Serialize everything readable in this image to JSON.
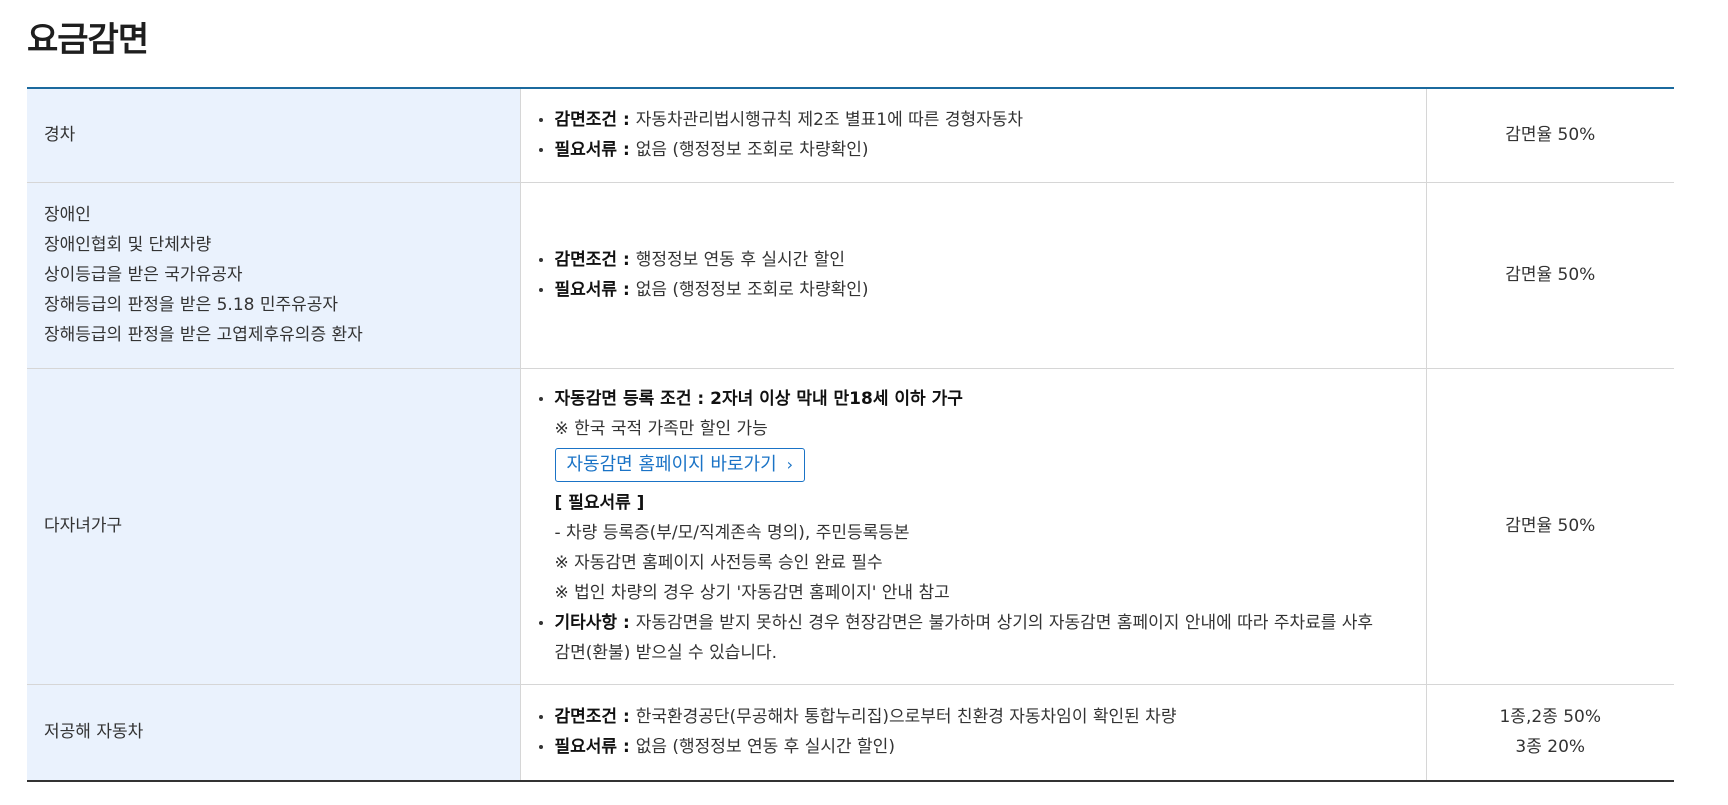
{
  "page_title": "요금감면",
  "rows": [
    {
      "targets": [
        "경차"
      ],
      "items": [
        {
          "label": "감면조건",
          "text": "자동차관리법시행규칙 제2조 별표1에 따른 경형자동차"
        },
        {
          "label": "필요서류",
          "text": "없음 (행정정보 조회로 차량확인)"
        }
      ],
      "rate": [
        "감면율 50%"
      ]
    },
    {
      "targets": [
        "장애인",
        "장애인협회 및 단체차량",
        "상이등급을 받은 국가유공자",
        "장해등급의 판정을 받은 5.18 민주유공자",
        "장해등급의 판정을 받은 고엽제후유의증 환자"
      ],
      "items": [
        {
          "label": "감면조건",
          "text": "행정정보 연동 후 실시간 할인"
        },
        {
          "label": "필요서류",
          "text": "없음 (행정정보 조회로 차량확인)"
        }
      ],
      "rate": [
        "감면율 50%"
      ]
    },
    {
      "targets": [
        "다자녀가구"
      ],
      "auto": {
        "label": "자동감면 등록 조건",
        "text": "2자녀 이상 막내 만18세 이하 가구",
        "note": "※ 한국 국적 가족만 할인 가능",
        "link_label": "자동감면 홈페이지 바로가기",
        "link_chevron": "›"
      },
      "docs": {
        "heading": "[ 필요서류 ]",
        "lines": [
          "- 차량 등록증(부/모/직계존속 명의), 주민등록등본",
          "※ 자동감면 홈페이지 사전등록 승인 완료 필수",
          "※ 법인 차량의 경우 상기 '자동감면 홈페이지' 안내 참고"
        ]
      },
      "etc": {
        "label": "기타사항",
        "text_line1": "자동감면을 받지 못하신 경우 현장감면은 불가하며 상기의 자동감면 홈페이지 안내에 따라 주차료를 사후",
        "text_line2": "감면(환불) 받으실 수 있습니다."
      },
      "rate": [
        "감면율 50%"
      ]
    },
    {
      "targets": [
        "저공해 자동차"
      ],
      "items": [
        {
          "label": "감면조건",
          "text": "한국환경공단(무공해차 통합누리집)으로부터 친환경 자동차임이 확인된 차량"
        },
        {
          "label": "필요서류",
          "text": "없음 (행정정보 연동 후 실시간 할인)"
        }
      ],
      "rate": [
        "1종,2종 50%",
        "3종 20%"
      ]
    }
  ]
}
